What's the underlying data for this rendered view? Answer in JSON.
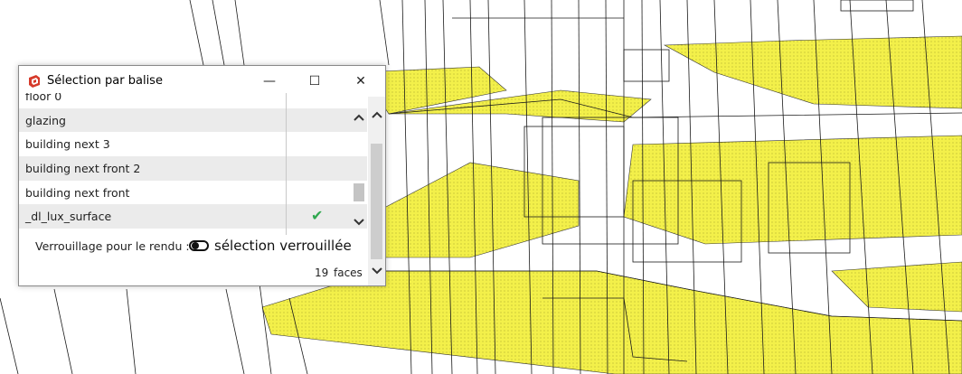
{
  "window": {
    "title": "Sélection par balise",
    "minimize_glyph": "—",
    "maximize_glyph": "☐",
    "close_glyph": "✕"
  },
  "tags": [
    {
      "name": "floor 0",
      "selected": false
    },
    {
      "name": "glazing",
      "selected": false
    },
    {
      "name": "building next 3",
      "selected": false
    },
    {
      "name": "building next front 2",
      "selected": false
    },
    {
      "name": "building next front",
      "selected": false
    },
    {
      "name": "_dl_lux_surface",
      "selected": true
    }
  ],
  "check_glyph": "✔",
  "lock": {
    "label": "Verrouillage pour le rendu :",
    "state_text": "sélection verrouillée",
    "enabled": true
  },
  "face_count": "19",
  "face_unit": "faces",
  "colors": {
    "plane_fill": "#f3f04a",
    "wireframe": "#1a1a1a",
    "check": "#2fa84f",
    "app_icon": "#d63a2a"
  },
  "icons": {
    "app": "sketchup-logo-icon",
    "scroll_up": "chevron-up-icon",
    "scroll_down": "chevron-down-icon"
  }
}
